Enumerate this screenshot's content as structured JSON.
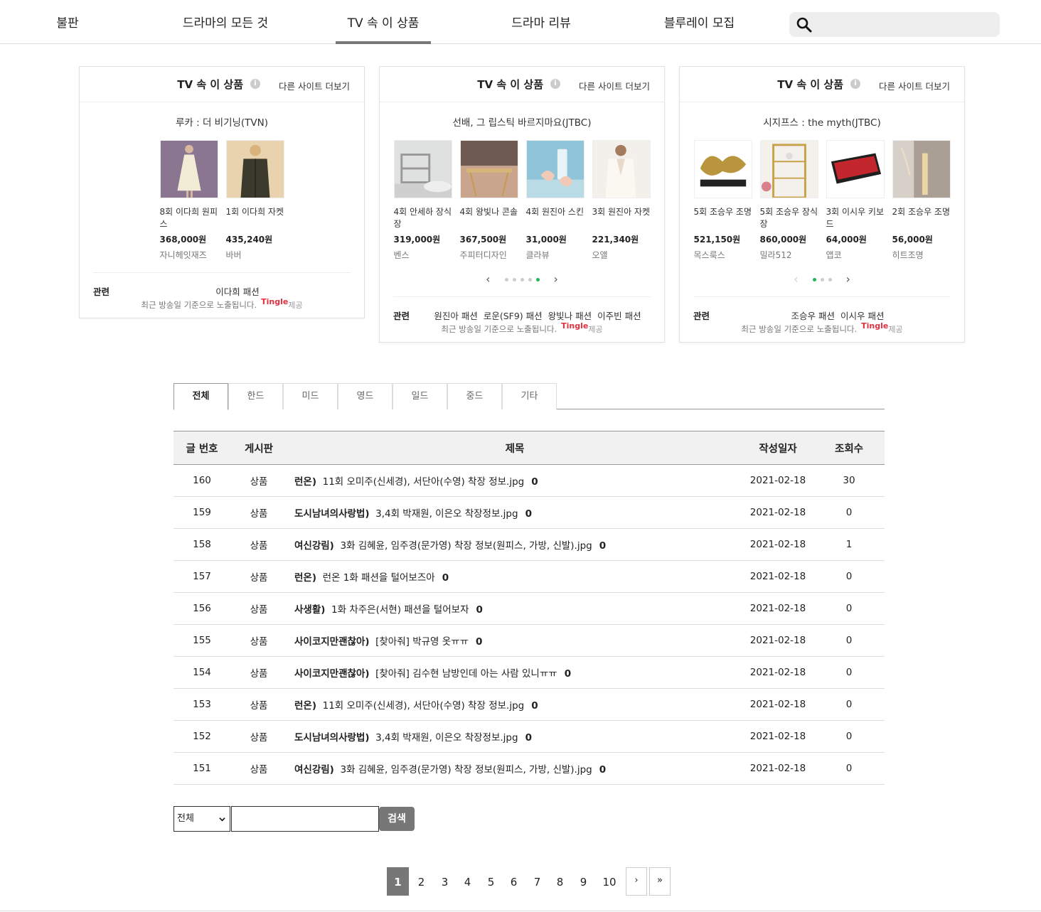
{
  "nav": {
    "items": [
      "불판",
      "드라마의 모든 것",
      "TV 속 이 상품",
      "드라마 리뷰",
      "블루레이 모집"
    ],
    "active_index": 2,
    "search_placeholder": ""
  },
  "widgets": [
    {
      "title": "TV 속 이 상품",
      "more": "다른 사이트 더보기",
      "drama": "루카 : 더 비기닝(TVN)",
      "products": [
        {
          "name": "8회 이다희 원피스",
          "price": "368,000원",
          "shop": "자니헤잇재즈",
          "thumb": "dress-icon"
        },
        {
          "name": "1회 이다희 자켓",
          "price": "435,240원",
          "shop": "바버",
          "thumb": "jacket-icon"
        }
      ],
      "show_dots": false,
      "dots": 0,
      "active_dot": -1,
      "related_label": "관련",
      "related_tags": [
        "이다희 패션"
      ],
      "note": "최근 방송일 기준으로 노출됩니다.",
      "brand": "Tingle",
      "provide": "제공"
    },
    {
      "title": "TV 속 이 상품",
      "more": "다른 사이트 더보기",
      "drama": "선배, 그 립스틱 바르지마요(JTBC)",
      "products": [
        {
          "name": "4회 안세하 장식장",
          "price": "319,000원",
          "shop": "벤스",
          "thumb": "shelf-icon"
        },
        {
          "name": "4회 왕빛나 콘솔",
          "price": "367,500원",
          "shop": "주피터디자인",
          "thumb": "console-icon"
        },
        {
          "name": "4회 원진아 스킨",
          "price": "31,000원",
          "shop": "클라뷰",
          "thumb": "skin-bottle-icon"
        },
        {
          "name": "3회 원진아 자켓",
          "price": "221,340원",
          "shop": "오앨",
          "thumb": "white-jacket-icon"
        }
      ],
      "show_dots": true,
      "dots": 5,
      "active_dot": 4,
      "related_label": "관련",
      "related_tags": [
        "원진아 패션",
        "로운(SF9) 패션",
        "왕빛나 패션",
        "이주빈 패션"
      ],
      "note": "최근 방송일 기준으로 노출됩니다.",
      "brand": "Tingle",
      "provide": "제공"
    },
    {
      "title": "TV 속 이 상품",
      "more": "다른 사이트 더보기",
      "drama": "시지프스 : the myth(JTBC)",
      "products": [
        {
          "name": "5회 조승우 조명",
          "price": "521,150원",
          "shop": "목스룩스",
          "thumb": "gold-lamp-icon"
        },
        {
          "name": "5회 조승우 장식장",
          "price": "860,000원",
          "shop": "밀라512",
          "thumb": "gold-shelf-icon"
        },
        {
          "name": "3회 이시우 키보드",
          "price": "64,000원",
          "shop": "앱코",
          "thumb": "keyboard-icon"
        },
        {
          "name": "2회 조승우 조명",
          "price": "56,000원",
          "shop": "히트조명",
          "thumb": "floor-lamp-icon"
        }
      ],
      "show_dots": true,
      "dots": 3,
      "active_dot": 0,
      "related_label": "관련",
      "related_tags": [
        "조승우 패션",
        "이시우 패션"
      ],
      "note": "최근 방송일 기준으로 노출됩니다.",
      "brand": "Tingle",
      "provide": "제공"
    }
  ],
  "tabs": {
    "items": [
      "전체",
      "한드",
      "미드",
      "영드",
      "일드",
      "중드",
      "기타"
    ],
    "active_index": 0
  },
  "table": {
    "headers": [
      "글 번호",
      "게시판",
      "제목",
      "작성일자",
      "조회수"
    ],
    "rows": [
      {
        "no": "160",
        "board": "상품",
        "cat": "런온)",
        "subject": "11회 오미주(신세경), 서단아(수영) 착장 정보.jpg",
        "comments": "0",
        "date": "2021-02-18",
        "views": "30"
      },
      {
        "no": "159",
        "board": "상품",
        "cat": "도시남녀의사랑법)",
        "subject": "3,4회 박재원, 이은오 착장정보.jpg",
        "comments": "0",
        "date": "2021-02-18",
        "views": "0"
      },
      {
        "no": "158",
        "board": "상품",
        "cat": "여신강림)",
        "subject": "3화 김혜윤, 임주경(문가영) 착장 정보(원피스, 가방, 신발).jpg",
        "comments": "0",
        "date": "2021-02-18",
        "views": "1"
      },
      {
        "no": "157",
        "board": "상품",
        "cat": "런온)",
        "subject": "런온 1화 패션을 털어보즈아",
        "comments": "0",
        "date": "2021-02-18",
        "views": "0"
      },
      {
        "no": "156",
        "board": "상품",
        "cat": "사생활)",
        "subject": "1화 차주은(서현) 패션을 털어보자",
        "comments": "0",
        "date": "2021-02-18",
        "views": "0"
      },
      {
        "no": "155",
        "board": "상품",
        "cat": "사이코지만괜찮아)",
        "subject": "[찾아줘] 박규영 옷ㅠㅠ",
        "comments": "0",
        "date": "2021-02-18",
        "views": "0"
      },
      {
        "no": "154",
        "board": "상품",
        "cat": "사이코지만괜찮아)",
        "subject": "[찾아줘] 김수현 남방인데 아는 사람 있니ㅠㅠ",
        "comments": "0",
        "date": "2021-02-18",
        "views": "0"
      },
      {
        "no": "153",
        "board": "상품",
        "cat": "런온)",
        "subject": "11회 오미주(신세경), 서단아(수영) 착장 정보.jpg",
        "comments": "0",
        "date": "2021-02-18",
        "views": "0"
      },
      {
        "no": "152",
        "board": "상품",
        "cat": "도시남녀의사랑법)",
        "subject": "3,4회 박재원, 이은오 착장정보.jpg",
        "comments": "0",
        "date": "2021-02-18",
        "views": "0"
      },
      {
        "no": "151",
        "board": "상품",
        "cat": "여신강림)",
        "subject": "3화 김혜윤, 임주경(문가영) 착장 정보(원피스, 가방, 신발).jpg",
        "comments": "0",
        "date": "2021-02-18",
        "views": "0"
      }
    ]
  },
  "search": {
    "select_value": "전체",
    "input_value": "",
    "button": "검색"
  },
  "pagination": {
    "pages": [
      "1",
      "2",
      "3",
      "4",
      "5",
      "6",
      "7",
      "8",
      "9",
      "10"
    ],
    "current": "1",
    "next": "›",
    "last": "»"
  },
  "colors": {
    "accent_green": "#1db954",
    "tingle_red": "#e2303f",
    "active_gray": "#777777"
  }
}
